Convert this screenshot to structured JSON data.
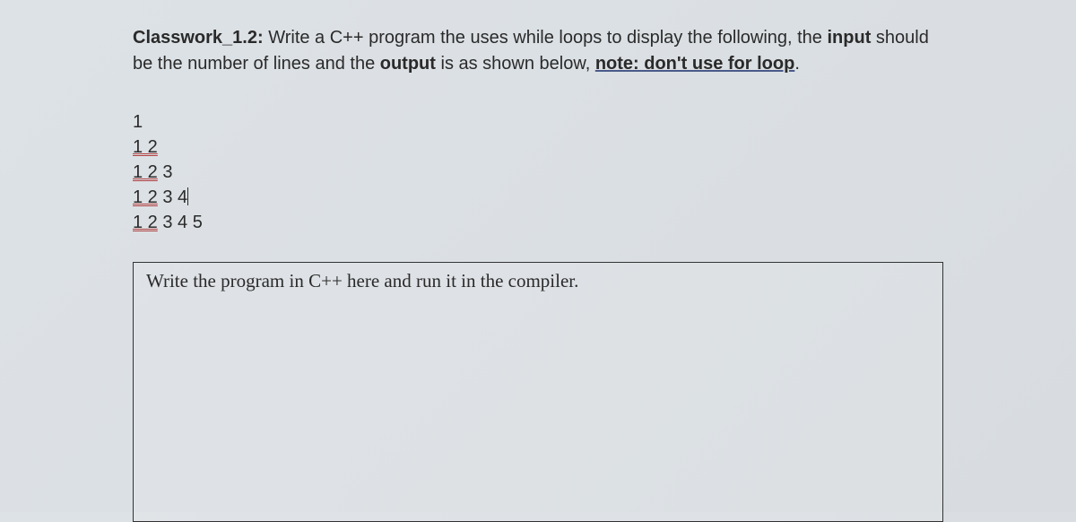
{
  "header": {
    "label_bold": "Classwork_1.2:",
    "desc_part1": " Write a C++ program the uses while loops to display the following, the ",
    "input_bold": "input",
    "desc_part2": " should be the number of lines and the ",
    "output_bold": "output",
    "desc_part3": " is as shown below, ",
    "note_underlined": "note: don't use for loop",
    "period": "."
  },
  "output": {
    "l1_p1": "1",
    "l2_u": "1 2",
    "l3_u": "1 2",
    "l3_r": " 3",
    "l4_u": "1 2",
    "l4_r": " 3 4",
    "l5_u": "1 2",
    "l5_r": " 3 4 5"
  },
  "answer": {
    "prompt": "Write the program in C++ here and run it in the compiler."
  }
}
